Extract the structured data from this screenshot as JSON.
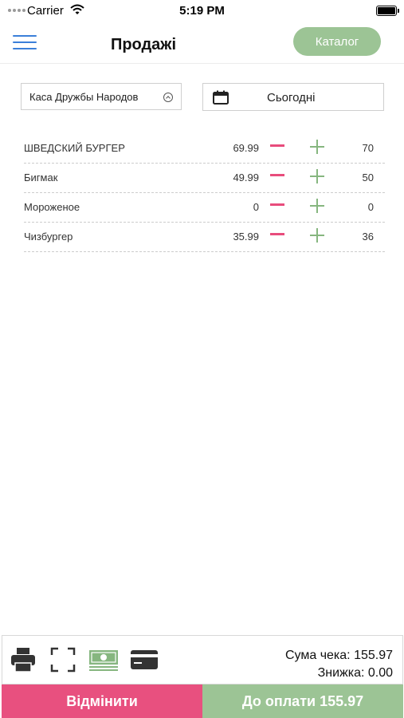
{
  "status_bar": {
    "carrier": "Carrier",
    "time": "5:19 PM"
  },
  "header": {
    "title": "Продажі",
    "catalog_label": "Каталог"
  },
  "filters": {
    "cashier": "Каса Дружбы Народов",
    "date": "Сьогодні"
  },
  "items": [
    {
      "name": "ШВЕДСКИЙ БУРГЕР",
      "price": "69.99",
      "qty": "70"
    },
    {
      "name": "Бигмак",
      "price": "49.99",
      "qty": "50"
    },
    {
      "name": "Мороженое",
      "price": "0",
      "qty": "0"
    },
    {
      "name": "Чизбургер",
      "price": "35.99",
      "qty": "36"
    }
  ],
  "totals": {
    "sum_label": "Сума чека: 155.97",
    "discount_label": "Знижка: 0.00"
  },
  "actions": {
    "cancel_label": "Відмінити",
    "pay_label": "До оплати 155.97"
  },
  "colors": {
    "accent_green": "#9cc495",
    "accent_pink": "#e8507f",
    "menu_blue": "#3b7fd9"
  }
}
